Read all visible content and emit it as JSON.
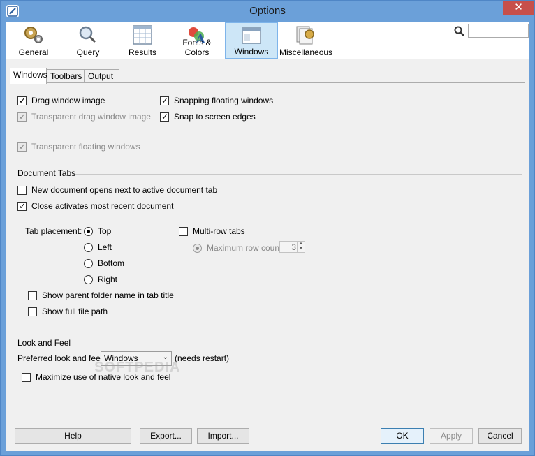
{
  "window": {
    "title": "Options",
    "close_label": "✕"
  },
  "toolbar": {
    "items": [
      {
        "label": "General",
        "icon": "gears-icon"
      },
      {
        "label": "Query",
        "icon": "magnifier-icon"
      },
      {
        "label": "Results",
        "icon": "table-icon"
      },
      {
        "label": "Fonts & Colors",
        "icon": "font-palette-icon"
      },
      {
        "label": "Windows",
        "icon": "window-icon"
      },
      {
        "label": "Miscellaneous",
        "icon": "misc-cards-icon"
      }
    ],
    "selected": "Windows",
    "search_value": ""
  },
  "subtabs": [
    "Windows",
    "Toolbars",
    "Output"
  ],
  "windows_tab": {
    "drag_window_image": "Drag window image",
    "transparent_drag_window_image": "Transparent drag window image",
    "transparent_floating_windows": "Transparent floating windows",
    "snapping_floating_windows": "Snapping floating windows",
    "snap_to_screen_edges": "Snap to screen edges",
    "document_tabs_section": "Document Tabs",
    "new_document_opens_next": "New document opens next to active document tab",
    "close_activates_most_recent": "Close activates most recent document",
    "tab_placement_label": "Tab placement:",
    "placement_options": [
      "Top",
      "Left",
      "Bottom",
      "Right"
    ],
    "placement_selected": "Top",
    "multi_row_tabs": "Multi-row tabs",
    "maximum_row_count_label": "Maximum row count:",
    "maximum_row_count_value": "3",
    "show_parent_folder_name": "Show parent folder name in tab title",
    "show_full_file_path": "Show full file path",
    "look_and_feel_section": "Look and Feel",
    "preferred_laf_label": "Preferred look and feel:",
    "preferred_laf_value": "Windows",
    "needs_restart": "(needs restart)",
    "maximize_native_laf": "Maximize use of native look and feel"
  },
  "buttons": {
    "help": "Help",
    "export": "Export...",
    "import": "Import...",
    "ok": "OK",
    "apply": "Apply",
    "cancel": "Cancel"
  },
  "watermark": "SOFTPEDIA"
}
